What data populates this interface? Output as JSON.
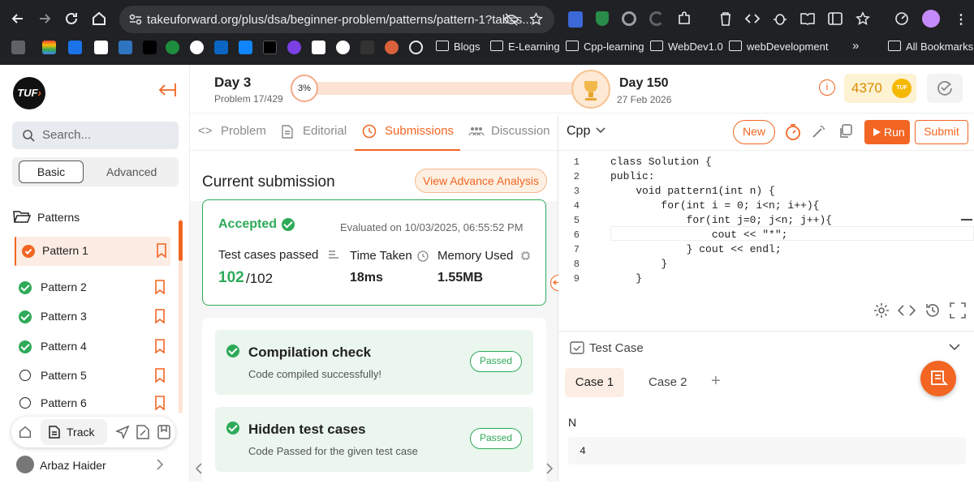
{
  "browser": {
    "url": "takeuforward.org/plus/dsa/beginner-problem/patterns/pattern-1?tab=s...",
    "bookmarks": [
      "Blogs",
      "E-Learning",
      "Cpp-learning",
      "WebDev1.0",
      "webDevelopment"
    ],
    "all_bookmarks": "All Bookmarks",
    "more": "»"
  },
  "sidebar": {
    "logo": "TUF",
    "search_placeholder": "Search...",
    "toggle": {
      "basic": "Basic",
      "advanced": "Advanced"
    },
    "section": "Patterns",
    "items": [
      {
        "label": "Pattern 1",
        "status": "active"
      },
      {
        "label": "Pattern 2",
        "status": "done"
      },
      {
        "label": "Pattern 3",
        "status": "done"
      },
      {
        "label": "Pattern 4",
        "status": "done"
      },
      {
        "label": "Pattern 5",
        "status": "todo"
      },
      {
        "label": "Pattern 6",
        "status": "todo"
      }
    ],
    "track_label": "Track",
    "user_name": "Arbaz Haider"
  },
  "header": {
    "day_start": "Day 3",
    "problem_progress": "Problem 17/429",
    "percent": "3%",
    "progress_fraction": 0.03,
    "day_end": "Day 150",
    "end_date": "27 Feb 2026",
    "coins": "4370",
    "coin_logo": "TUF"
  },
  "tabs": [
    {
      "label": "Problem",
      "icon": "code-icon"
    },
    {
      "label": "Editorial",
      "icon": "document-icon"
    },
    {
      "label": "Submissions",
      "icon": "clock-icon",
      "active": true
    },
    {
      "label": "Discussion",
      "icon": "people-icon"
    }
  ],
  "submission": {
    "title": "Current submission",
    "analysis_button": "View Advance Analysis",
    "status": "Accepted",
    "evaluated": "Evaluated on 10/03/2025, 06:55:52 PM",
    "tests_label": "Test cases passed",
    "tests_passed": "102",
    "tests_total": "/102",
    "time_label": "Time Taken",
    "time_value": "18ms",
    "memory_label": "Memory Used",
    "memory_value": "1.55MB",
    "checks": [
      {
        "title": "Compilation check",
        "desc": "Code compiled successfully!",
        "badge": "Passed"
      },
      {
        "title": "Hidden test cases",
        "desc": "Code Passed for the given test case",
        "badge": "Passed"
      }
    ]
  },
  "editor": {
    "language": "Cpp",
    "new_button": "New",
    "run_button": "Run",
    "submit_button": "Submit",
    "lines": [
      {
        "n": "1",
        "text": "class Solution {"
      },
      {
        "n": "2",
        "text": "public:"
      },
      {
        "n": "3",
        "text": "    void pattern1(int n) {"
      },
      {
        "n": "4",
        "text": "        for(int i = 0; i<n; i++){"
      },
      {
        "n": "5",
        "text": "            for(int j=0; j<n; j++){"
      },
      {
        "n": "6",
        "text": "                cout << \"*\";"
      },
      {
        "n": "7",
        "text": "            } cout << endl;"
      },
      {
        "n": "8",
        "text": "        }"
      },
      {
        "n": "9",
        "text": "    }"
      }
    ]
  },
  "testcase": {
    "title": "Test Case",
    "cases": [
      "Case 1",
      "Case 2"
    ],
    "add": "+",
    "param_name": "N",
    "param_value": "4"
  },
  "colors": {
    "accent": "#f26522",
    "green": "#2eaa58",
    "green_bg": "#eaf6ee"
  }
}
